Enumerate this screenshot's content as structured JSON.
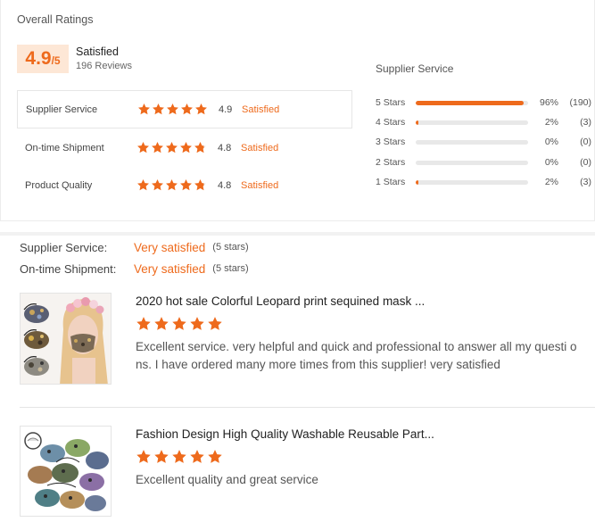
{
  "overall": {
    "title": "Overall Ratings",
    "score": "4.9",
    "score_suffix": "/5",
    "label": "Satisfied",
    "reviews": "196 Reviews"
  },
  "metrics": [
    {
      "name": "Supplier Service",
      "score": "4.9",
      "status": "Satisfied",
      "stars": 5
    },
    {
      "name": "On-time Shipment",
      "score": "4.8",
      "status": "Satisfied",
      "stars": 4.8
    },
    {
      "name": "Product Quality",
      "score": "4.8",
      "status": "Satisfied",
      "stars": 4.8
    }
  ],
  "distribution": {
    "title": "Supplier Service",
    "rows": [
      {
        "label": "5 Stars",
        "fraction": 0.96,
        "pct": "96%",
        "count": "(190)"
      },
      {
        "label": "4 Stars",
        "fraction": 0.02,
        "pct": "2%",
        "count": "(3)"
      },
      {
        "label": "3 Stars",
        "fraction": 0.0,
        "pct": "0%",
        "count": "(0)"
      },
      {
        "label": "2 Stars",
        "fraction": 0.0,
        "pct": "0%",
        "count": "(0)"
      },
      {
        "label": "1 Stars",
        "fraction": 0.02,
        "pct": "2%",
        "count": "(3)"
      }
    ]
  },
  "summary": [
    {
      "label": "Supplier Service:",
      "value": "Very satisfied",
      "sub": "(5 stars)"
    },
    {
      "label": "On-time Shipment:",
      "value": "Very satisfied",
      "sub": "(5 stars)"
    }
  ],
  "reviews": [
    {
      "title": "2020 hot sale Colorful Leopard print sequined mask ...",
      "stars": 5,
      "text": "Excellent service. very helpful and quick and professional to answer all my questi ons. I have ordered many more times from this supplier! very satisfied"
    },
    {
      "title": "Fashion Design High Quality Washable Reusable Part...",
      "stars": 5,
      "text": "Excellent quality and great service"
    }
  ],
  "colors": {
    "accent": "#ee6a1c",
    "accent_bg": "#fde7d6",
    "track": "#e8e8e8"
  },
  "icons": {
    "star": "star-icon",
    "product_photo": "product-thumbnail"
  }
}
